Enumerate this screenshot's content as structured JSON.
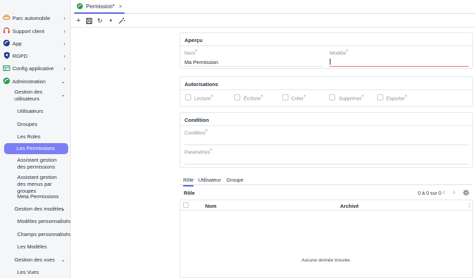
{
  "sidebar": {
    "items": [
      {
        "label": "Parc automobile"
      },
      {
        "label": "Support client"
      },
      {
        "label": "App"
      },
      {
        "label": "RGPD"
      },
      {
        "label": "Config applicative"
      },
      {
        "label": "Administration"
      }
    ],
    "admin_children": [
      {
        "label": "Gestion des utilisateurs"
      },
      {
        "label": "Utilisateurs"
      },
      {
        "label": "Groupes"
      },
      {
        "label": "Les Roles"
      },
      {
        "label": "Les Permissions"
      },
      {
        "label": "Assistant gestion des permissions"
      },
      {
        "label": "Assistant gestion des menus par groupes"
      },
      {
        "label": "Meta Permissions"
      },
      {
        "label": "Gestion des modèles"
      },
      {
        "label": "Modèles personnalisés"
      },
      {
        "label": "Champs personnalisés"
      },
      {
        "label": "Les Modèles"
      },
      {
        "label": "Gestion des vues"
      },
      {
        "label": "Les Vues"
      }
    ]
  },
  "tab": {
    "label": "Permission*",
    "close": "×"
  },
  "toolbar": {
    "add": "+",
    "save_icon": "save-icon",
    "refresh": "↻",
    "more": "▾",
    "tools": "✧"
  },
  "apercu": {
    "title": "Aperçu",
    "nom_label": "Nom",
    "nom_value": "Ma Permission",
    "modele_label": "Modèle",
    "modele_value": ""
  },
  "autorisations": {
    "title": "Autorisations",
    "items": [
      "Lecture",
      "Écriture",
      "Créer",
      "Supprimer",
      "Exporter"
    ]
  },
  "condition": {
    "title": "Condition",
    "condition_label": "Condition",
    "parametres_label": "Paramètres"
  },
  "subtabs": [
    "Rôle",
    "Utilisateur",
    "Groupe"
  ],
  "grid": {
    "title": "Rôle",
    "pager": "0 à 0 sur 0",
    "columns": [
      "Nom",
      "Archivé"
    ],
    "empty": "Aucune donnée trouvée."
  },
  "colors": {
    "accent": "#5b63d8",
    "active_item": "#7b7ff3",
    "error": "#e57373"
  }
}
